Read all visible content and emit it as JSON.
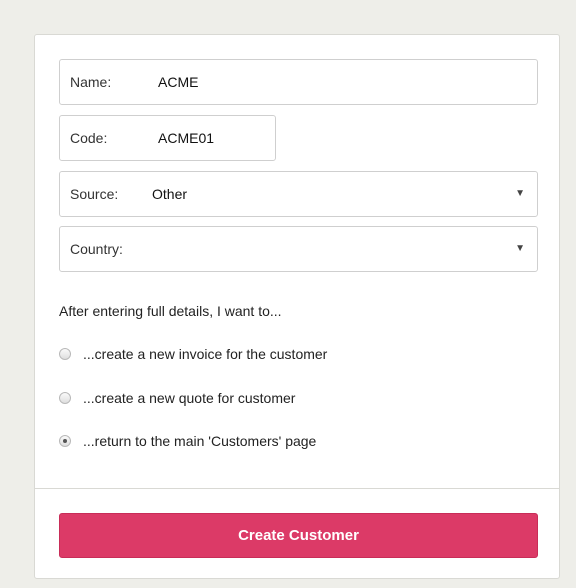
{
  "form": {
    "name": {
      "label": "Name:",
      "value": "ACME"
    },
    "code": {
      "label": "Code:",
      "value": "ACME01"
    },
    "source": {
      "label": "Source:",
      "value": "Other"
    },
    "country": {
      "label": "Country:",
      "value": ""
    },
    "intro_text": "After entering full details, I want to...",
    "options": [
      {
        "label": "...create a new invoice for the customer",
        "checked": false
      },
      {
        "label": "...create a new quote for customer",
        "checked": false
      },
      {
        "label": "...return to the main 'Customers' page",
        "checked": true
      }
    ],
    "submit_label": "Create Customer"
  },
  "colors": {
    "page_bg": "#eeeee9",
    "accent": "#dc3a67"
  },
  "icons": {
    "dropdown_caret": "▼"
  }
}
